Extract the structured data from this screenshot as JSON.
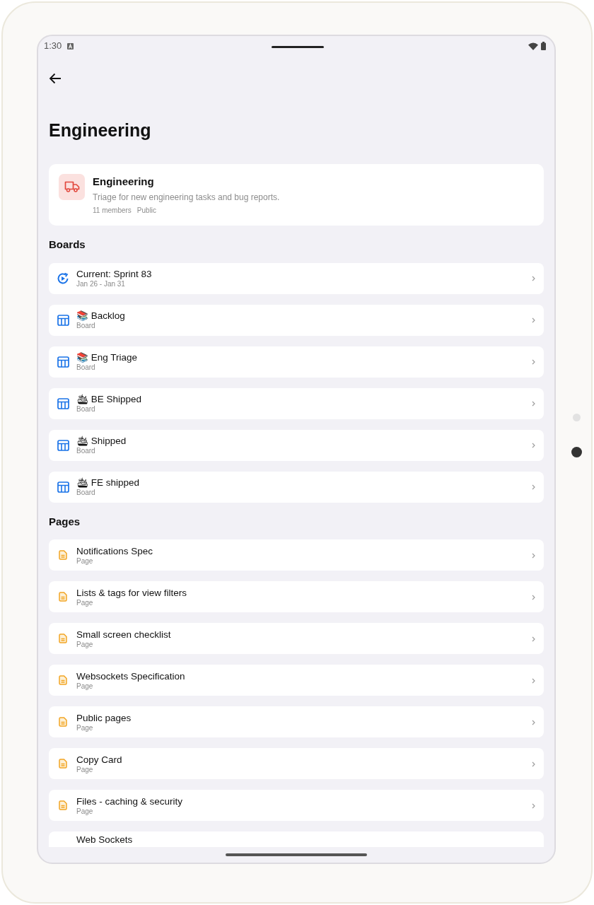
{
  "status_bar": {
    "time": "1:30"
  },
  "page": {
    "title": "Engineering"
  },
  "team": {
    "name": "Engineering",
    "description": "Triage for new engineering tasks and bug reports.",
    "members": "11 members",
    "visibility": "Public"
  },
  "sections": [
    {
      "title": "Boards",
      "items": [
        {
          "kind": "sprint",
          "title": "Current: Sprint 83",
          "subtitle": "Jan 26 - Jan 31"
        },
        {
          "kind": "board",
          "title": "📚 Backlog",
          "subtitle": "Board"
        },
        {
          "kind": "board",
          "title": "📚 Eng Triage",
          "subtitle": "Board"
        },
        {
          "kind": "board",
          "title": "🛳 BE Shipped",
          "subtitle": "Board"
        },
        {
          "kind": "board",
          "title": "🛳 Shipped",
          "subtitle": "Board"
        },
        {
          "kind": "board",
          "title": "🛳 FE shipped",
          "subtitle": "Board"
        }
      ]
    },
    {
      "title": "Pages",
      "items": [
        {
          "kind": "page",
          "title": "Notifications Spec",
          "subtitle": "Page"
        },
        {
          "kind": "page",
          "title": "Lists & tags for view filters",
          "subtitle": "Page"
        },
        {
          "kind": "page",
          "title": "Small screen checklist",
          "subtitle": "Page"
        },
        {
          "kind": "page",
          "title": "Websockets Specification",
          "subtitle": "Page"
        },
        {
          "kind": "page",
          "title": "Public pages",
          "subtitle": "Page"
        },
        {
          "kind": "page",
          "title": "Copy Card",
          "subtitle": "Page"
        },
        {
          "kind": "page",
          "title": "Files - caching & security",
          "subtitle": "Page"
        },
        {
          "kind": "partial",
          "title": "Web Sockets"
        }
      ]
    }
  ]
}
